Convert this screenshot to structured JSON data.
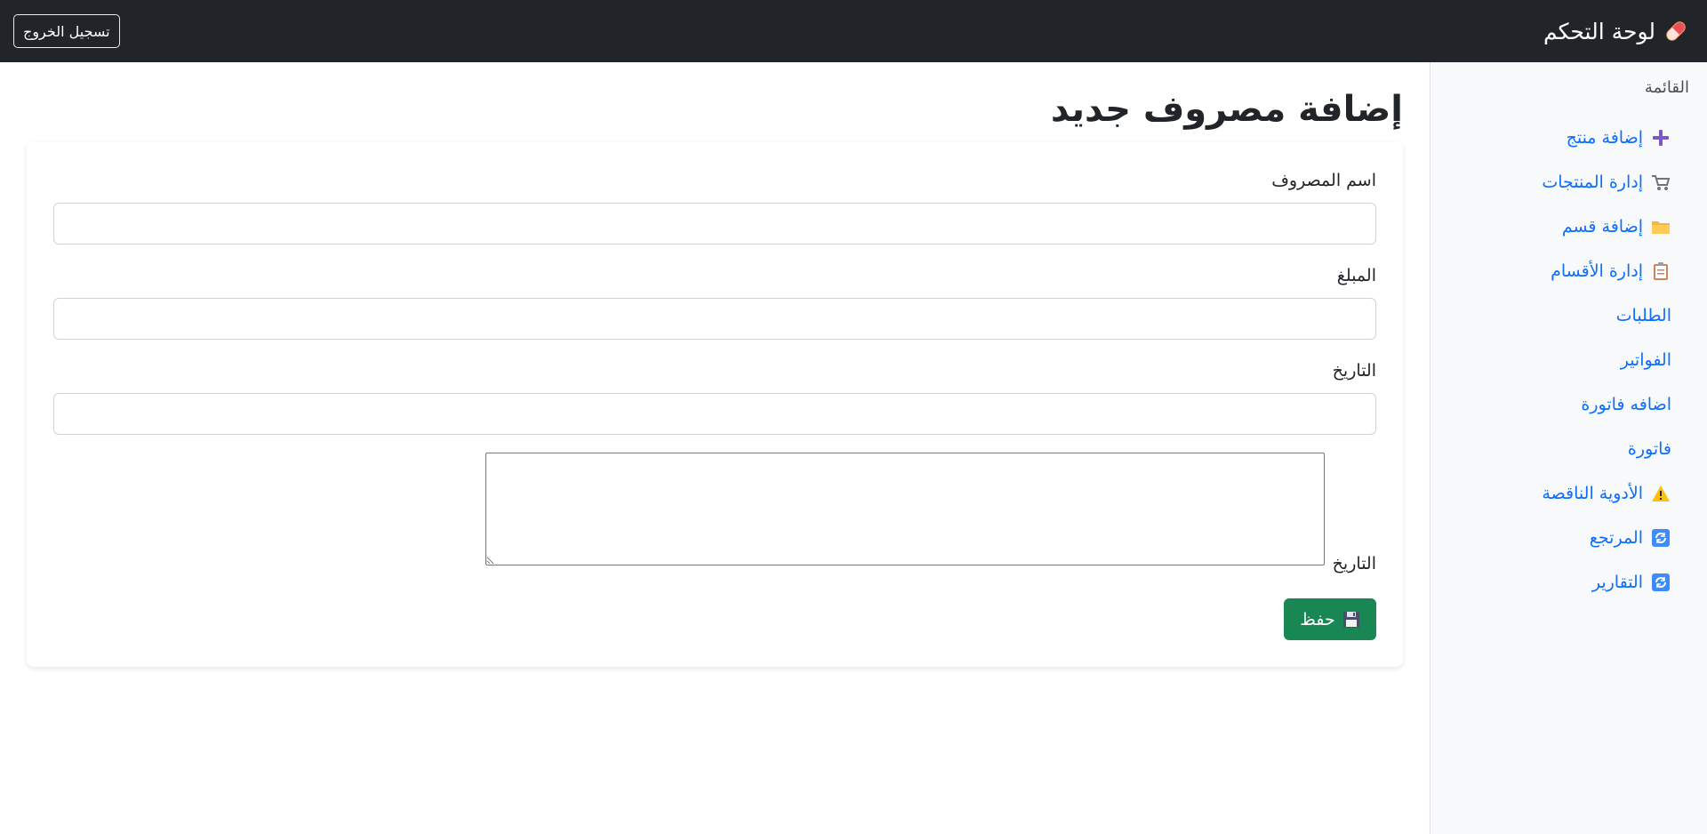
{
  "navbar": {
    "brand": "لوحة التحكم",
    "brand_icon": "pill-icon",
    "logout_label": "تسجيل الخروج"
  },
  "sidebar": {
    "heading": "القائمة",
    "items": [
      {
        "label": "إضافة منتج",
        "icon": "plus-icon"
      },
      {
        "label": "إدارة المنتجات",
        "icon": "cart-icon"
      },
      {
        "label": "إضافة قسم",
        "icon": "folder-icon"
      },
      {
        "label": "إدارة الأقسام",
        "icon": "clipboard-icon"
      },
      {
        "label": "الطلبات",
        "icon": ""
      },
      {
        "label": "الفواتير",
        "icon": ""
      },
      {
        "label": "اضافه فاتورة",
        "icon": ""
      },
      {
        "label": "فاتورة",
        "icon": ""
      },
      {
        "label": "الأدوية الناقصة",
        "icon": "warning-icon"
      },
      {
        "label": "المرتجع",
        "icon": "refresh-icon"
      },
      {
        "label": "التقارير",
        "icon": "refresh-icon"
      }
    ]
  },
  "main": {
    "title": "إضافة مصروف جديد",
    "form": {
      "name_label": "اسم المصروف",
      "name_value": "",
      "amount_label": "المبلغ",
      "amount_value": "",
      "date_label": "التاريخ",
      "date_value": "",
      "notes_label": "التاريخ",
      "notes_value": "",
      "save_label": "حفظ",
      "save_icon": "floppy-disk-icon"
    }
  },
  "colors": {
    "navbar_bg": "#212529",
    "link": "#0d6efd",
    "save_button": "#198754",
    "sidebar_bg": "#f8f9fa"
  }
}
